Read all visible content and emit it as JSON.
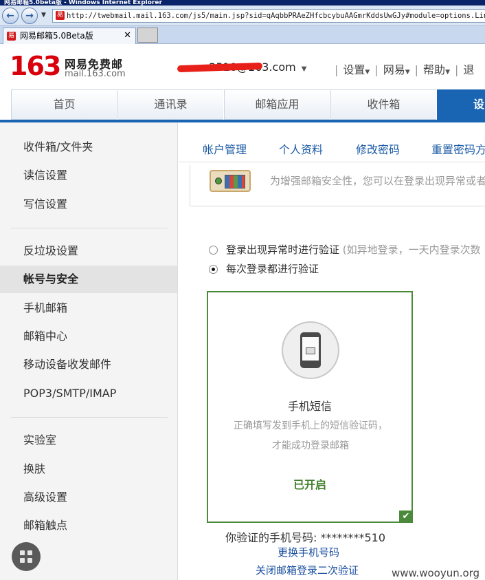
{
  "browser": {
    "window_title": "网易邮箱5.0beta版 - Windows Internet Explorer",
    "back_icon": "back-arrow-icon",
    "forward_icon": "forward-arrow-icon",
    "url": "http://twebmail.mail.163.com/js5/main.jsp?sid=qAqbbPRAeZHfcbcybuAAGmrKddsUwGJy#module=options.LinkModule",
    "tab_title": "网易邮箱5.0Beta版",
    "tab_close": "✕"
  },
  "header": {
    "logo_number": "163",
    "logo_name": "网易免费邮",
    "logo_domain": "mail.163.com",
    "account": "****12510@163.com",
    "account_visible": "2510@163.com",
    "links": [
      "设置",
      "网易",
      "帮助",
      "退"
    ]
  },
  "main_nav": {
    "tabs": [
      {
        "label": "首页",
        "active": false
      },
      {
        "label": "通讯录",
        "active": false
      },
      {
        "label": "邮箱应用",
        "active": false
      },
      {
        "label": "收件箱",
        "active": false
      },
      {
        "label": "设",
        "active": true
      }
    ]
  },
  "sidebar": {
    "group1": [
      "收件箱/文件夹",
      "读信设置",
      "写信设置"
    ],
    "group2": [
      "反垃圾设置",
      "帐号与安全",
      "手机邮箱",
      "邮箱中心",
      "移动设备收发邮件",
      "POP3/SMTP/IMAP"
    ],
    "group3": [
      "实验室",
      "换肤",
      "高级设置",
      "邮箱触点"
    ],
    "active": "帐号与安全"
  },
  "subtabs": [
    "帐户管理",
    "个人资料",
    "修改密码",
    "重置密码方"
  ],
  "notice": "为增强邮箱安全性，您可以在登录出现异常或者",
  "options": [
    {
      "label": "登录出现异常时进行验证",
      "note": "(如异地登录，一天内登录次数",
      "selected": false
    },
    {
      "label": "每次登录都进行验证",
      "note": "",
      "selected": true
    }
  ],
  "card": {
    "icon": "phone-sms-icon",
    "title": "手机短信",
    "description": "正确填写发到手机上的短信验证码，才能成功登录邮箱",
    "status": "已开启",
    "border_color": "#4a8a3a"
  },
  "verified_phone_label": "你验证的手机号码:",
  "verified_phone": "********510",
  "change_phone_link": "更换手机号码",
  "disable_link": "关闭邮箱登录二次验证",
  "watermark": "www.wooyun.org",
  "colors": {
    "brand_red": "#d8000c",
    "nav_blue": "#1a64b4",
    "link_blue": "#1a4fa0",
    "status_green": "#3f7f2a"
  }
}
